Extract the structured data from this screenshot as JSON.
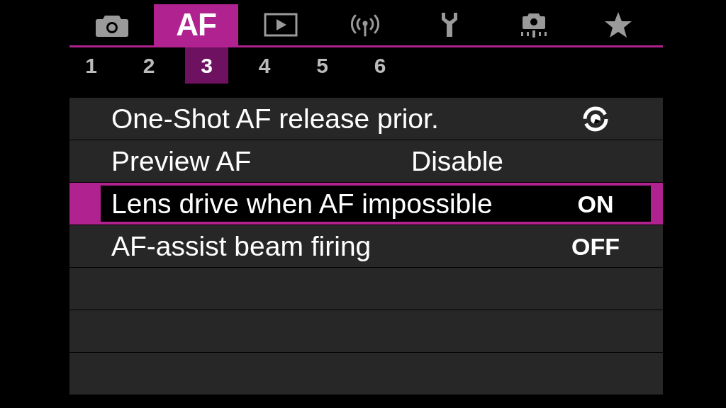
{
  "tabs": [
    {
      "kind": "camera",
      "selected": false
    },
    {
      "kind": "text",
      "label": "AF",
      "selected": true
    },
    {
      "kind": "playback",
      "selected": false
    },
    {
      "kind": "wireless",
      "selected": false
    },
    {
      "kind": "setup",
      "selected": false
    },
    {
      "kind": "custom",
      "selected": false
    },
    {
      "kind": "star",
      "selected": false
    }
  ],
  "pages": [
    {
      "label": "1",
      "selected": false
    },
    {
      "label": "2",
      "selected": false
    },
    {
      "label": "3",
      "selected": true
    },
    {
      "label": "4",
      "selected": false
    },
    {
      "label": "5",
      "selected": false
    },
    {
      "label": "6",
      "selected": false
    }
  ],
  "menu": {
    "rows": [
      {
        "label": "One-Shot AF release prior.",
        "kind": "icon",
        "selected": false
      },
      {
        "label": "Preview AF",
        "kind": "text",
        "value": "Disable",
        "selected": false
      },
      {
        "label": "Lens drive when AF impossible",
        "kind": "toggle",
        "value": "ON",
        "selected": true
      },
      {
        "label": "AF-assist beam firing",
        "kind": "toggle",
        "value": "OFF",
        "selected": false
      }
    ]
  }
}
